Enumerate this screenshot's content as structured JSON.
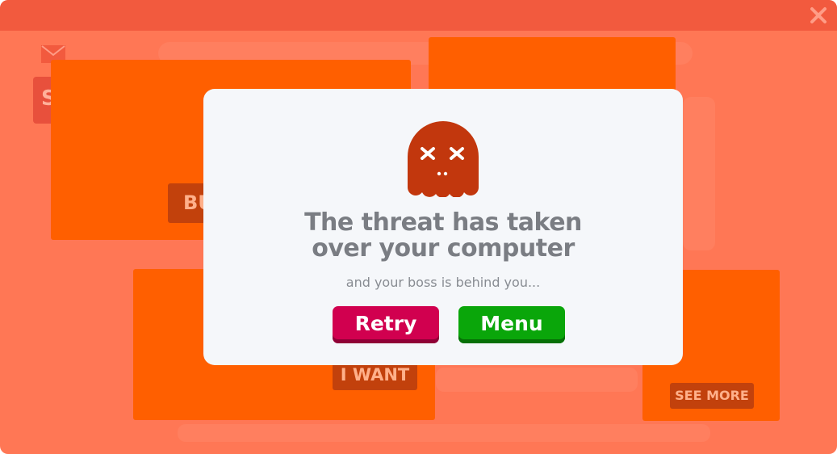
{
  "window": {
    "close_icon": "close-icon",
    "colors": {
      "frame": "#ff7755",
      "titlebar": "#f25a3e",
      "ad": "#ff5f00",
      "ad_button": "#c2410c"
    }
  },
  "background_ads": {
    "stub_letter": "S",
    "buy_label": "BU",
    "want_label": "I WANT",
    "see_more_label": "SEE MORE"
  },
  "dialog": {
    "icon": "dead-ghost-icon",
    "title_line1": "The threat has taken",
    "title_line2": "over your computer",
    "subtitle": "and your boss is behind you...",
    "retry_label": "Retry",
    "menu_label": "Menu",
    "colors": {
      "retry": "#d1004f",
      "menu": "#0aa60a",
      "ghost": "#c2370d"
    }
  }
}
